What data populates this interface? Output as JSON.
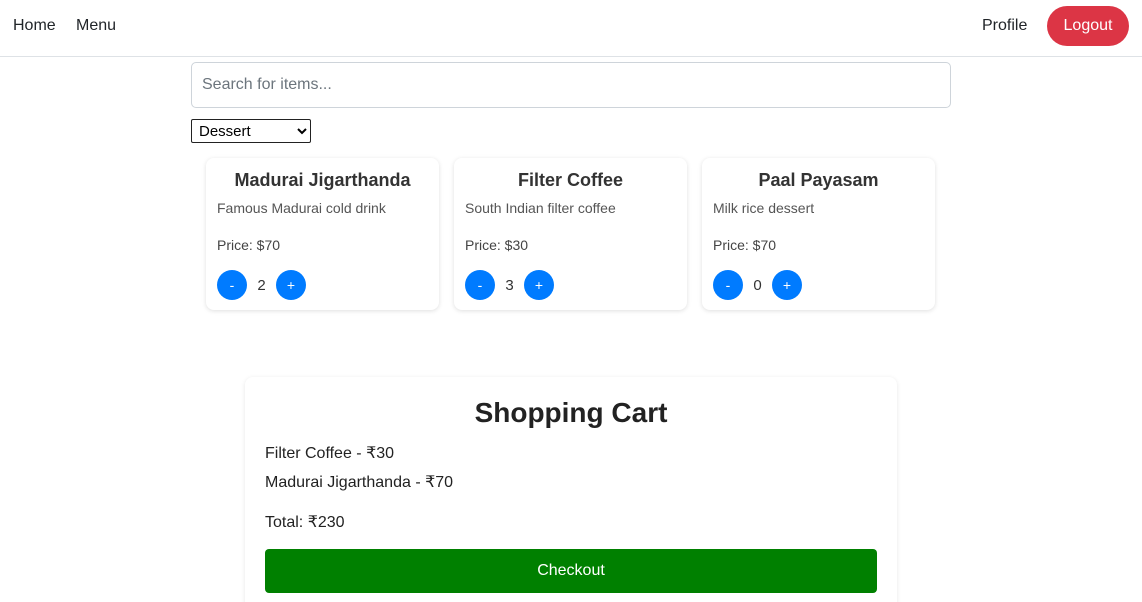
{
  "nav": {
    "home": "Home",
    "menu": "Menu",
    "profile": "Profile",
    "logout": "Logout"
  },
  "search": {
    "placeholder": "Search for items...",
    "value": ""
  },
  "category": {
    "selected": "Dessert"
  },
  "items": [
    {
      "name": "Madurai Jigarthanda",
      "description": "Famous Madurai cold drink",
      "price": "Price: $70",
      "quantity": "2"
    },
    {
      "name": "Filter Coffee",
      "description": "South Indian filter coffee",
      "price": "Price: $30",
      "quantity": "3"
    },
    {
      "name": "Paal Payasam",
      "description": "Milk rice dessert",
      "price": "Price: $70",
      "quantity": "0"
    }
  ],
  "qty_controls": {
    "minus": "-",
    "plus": "+"
  },
  "cart": {
    "title": "Shopping Cart",
    "lines": [
      "Filter Coffee - ₹30",
      "Madurai Jigarthanda - ₹70"
    ],
    "total": "Total: ₹230",
    "checkout": "Checkout"
  },
  "colors": {
    "logout": "#dc3545",
    "qty_button": "#007bff",
    "checkout": "#008000"
  }
}
